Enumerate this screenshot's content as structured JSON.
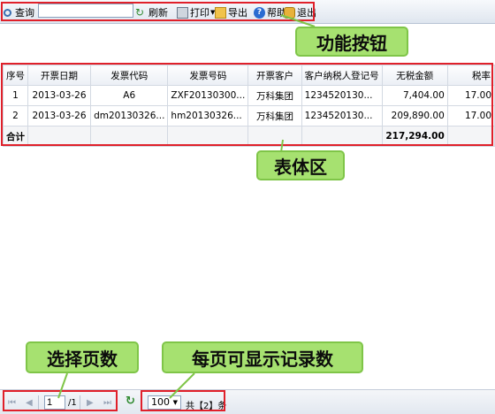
{
  "toolbar": {
    "query_label": "查询",
    "search_value": "",
    "refresh_label": "刷新",
    "print_label": "打印",
    "export_label": "导出",
    "help_label": "帮助",
    "exit_label": "退出"
  },
  "callouts": {
    "buttons": "功能按钮",
    "table": "表体区",
    "page_select": "选择页数",
    "page_size": "每页可显示记录数"
  },
  "table": {
    "headers": [
      "序号",
      "开票日期",
      "发票代码",
      "发票号码",
      "开票客户",
      "客户纳税人登记号",
      "无税金额",
      "税率"
    ],
    "rows": [
      [
        "1",
        "2013-03-26",
        "A6",
        "ZXF20130300...",
        "万科集团",
        "1234520130...",
        "7,404.00",
        "17.00"
      ],
      [
        "2",
        "2013-03-26",
        "dm20130326...",
        "hm20130326...",
        "万科集团",
        "1234520130...",
        "209,890.00",
        "17.00"
      ]
    ],
    "total_label": "合计",
    "total_amount": "217,294.00"
  },
  "pager": {
    "current_page": "1",
    "total_pages": "/1",
    "page_size": "100",
    "record_count": "共【2】条"
  },
  "colors": {
    "highlight_border": "#e0202a",
    "callout_bg": "#a6e170",
    "callout_border": "#7fc548"
  }
}
